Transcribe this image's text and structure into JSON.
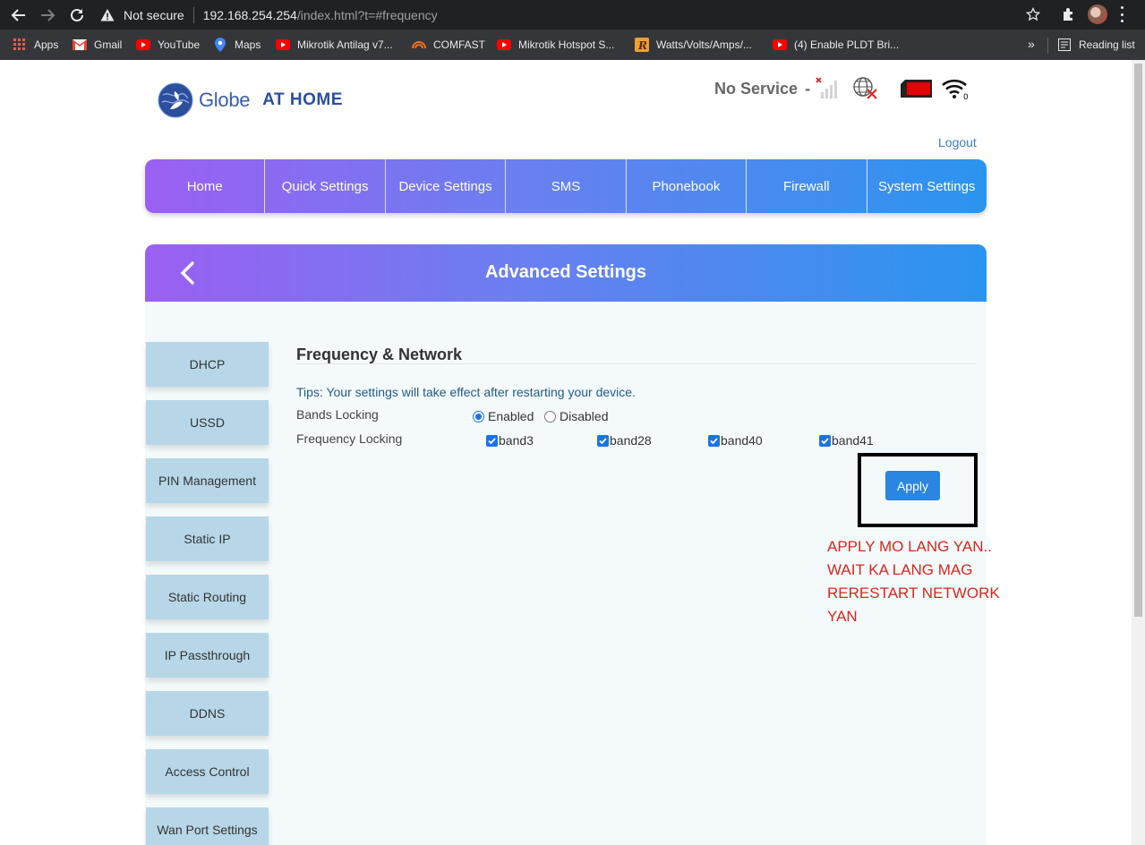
{
  "browser": {
    "not_secure": "Not secure",
    "url_host": "192.168.254.254",
    "url_path": "/index.html?t=#frequency",
    "bookmarks": [
      {
        "label": "Apps",
        "icon": "apps-grid-icon"
      },
      {
        "label": "Gmail",
        "icon": "gmail-icon"
      },
      {
        "label": "YouTube",
        "icon": "youtube-icon"
      },
      {
        "label": "Maps",
        "icon": "maps-pin-icon"
      },
      {
        "label": "Mikrotik Antilag v7...",
        "icon": "youtube-icon"
      },
      {
        "label": "COMFAST",
        "icon": "comfast-icon"
      },
      {
        "label": "Mikrotik Hotspot S...",
        "icon": "youtube-icon"
      },
      {
        "label": "Watts/Volts/Amps/...",
        "icon": "r-logo-icon"
      },
      {
        "label": "(4) Enable PLDT Bri...",
        "icon": "youtube-icon"
      }
    ],
    "more": "»",
    "reading_list": "Reading list"
  },
  "header": {
    "logo_globe": "Globe",
    "logo_home": "AT HOME",
    "status_text": "No Service",
    "status_dash": "-",
    "wifi_count": "0",
    "logout": "Logout"
  },
  "nav": [
    {
      "label": "Home"
    },
    {
      "label": "Quick Settings"
    },
    {
      "label": "Device Settings"
    },
    {
      "label": "SMS"
    },
    {
      "label": "Phonebook"
    },
    {
      "label": "Firewall"
    },
    {
      "label": "System Settings"
    }
  ],
  "panel": {
    "title": "Advanced Settings"
  },
  "sidebar": [
    {
      "label": "DHCP"
    },
    {
      "label": "USSD"
    },
    {
      "label": "PIN Management"
    },
    {
      "label": "Static IP"
    },
    {
      "label": "Static Routing"
    },
    {
      "label": "IP Passthrough"
    },
    {
      "label": "DDNS"
    },
    {
      "label": "Access Control"
    },
    {
      "label": "Wan Port Settings"
    }
  ],
  "form": {
    "section_title": "Frequency & Network",
    "tips": "Tips: Your settings will take effect after restarting your device.",
    "bands_locking": {
      "label": "Bands Locking",
      "options": [
        {
          "label": "Enabled",
          "selected": true
        },
        {
          "label": "Disabled",
          "selected": false
        }
      ]
    },
    "frequency_locking": {
      "label": "Frequency Locking",
      "bands": [
        {
          "label": "band3",
          "checked": true
        },
        {
          "label": "band28",
          "checked": true
        },
        {
          "label": "band40",
          "checked": true
        },
        {
          "label": "band41",
          "checked": true
        }
      ]
    },
    "apply": "Apply"
  },
  "annotation": {
    "lines": [
      "APPLY MO LANG YAN..",
      "WAIT KA LANG MAG",
      "RERESTART NETWORK",
      "YAN"
    ],
    "color": "#d9261c"
  },
  "colors": {
    "nav_gradient_start": "#9b5ff2",
    "nav_gradient_end": "#2a95ef",
    "sidebar_item": "#b7d7e8",
    "apply_button": "#2a86e0",
    "link": "#3b7cc9"
  }
}
